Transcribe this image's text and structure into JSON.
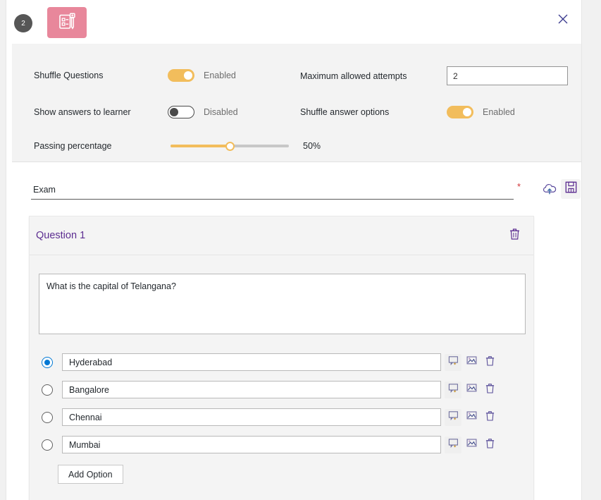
{
  "header": {
    "step_badge": "2",
    "tile_icon": "quiz-clipboard-icon",
    "close_icon": "close-icon",
    "tile_color": "#e8879b"
  },
  "settings": {
    "shuffle_questions": {
      "label": "Shuffle Questions",
      "state_label": "Enabled",
      "on": true
    },
    "show_answers": {
      "label": "Show answers to learner",
      "state_label": "Disabled",
      "on": false
    },
    "passing_percentage": {
      "label": "Passing percentage",
      "value_label": "50%",
      "value": 50
    },
    "max_attempts": {
      "label": "Maximum allowed attempts",
      "value": "2",
      "placeholder": ""
    },
    "shuffle_answers": {
      "label": "Shuffle answer options",
      "state_label": "Enabled",
      "on": true
    }
  },
  "exam": {
    "title_value": "Exam",
    "title_placeholder": "Name",
    "required_marker": "*",
    "publish_icon": "cloud-upload-icon",
    "save_icon": "save-floppy-icon"
  },
  "question": {
    "title": "Question 1",
    "delete_icon": "trash-icon",
    "text_value": "What is the capital of Telangana?",
    "text_placeholder": "Enter question",
    "accent_color": "#5c2d91",
    "add_option_label": "Add Option",
    "options": [
      {
        "text": "Hyderabad",
        "correct": true
      },
      {
        "text": "Bangalore",
        "correct": false
      },
      {
        "text": "Chennai",
        "correct": false
      },
      {
        "text": "Mumbai",
        "correct": false
      }
    ],
    "option_icons": [
      "comment-add-icon",
      "image-icon",
      "trash-icon"
    ]
  }
}
